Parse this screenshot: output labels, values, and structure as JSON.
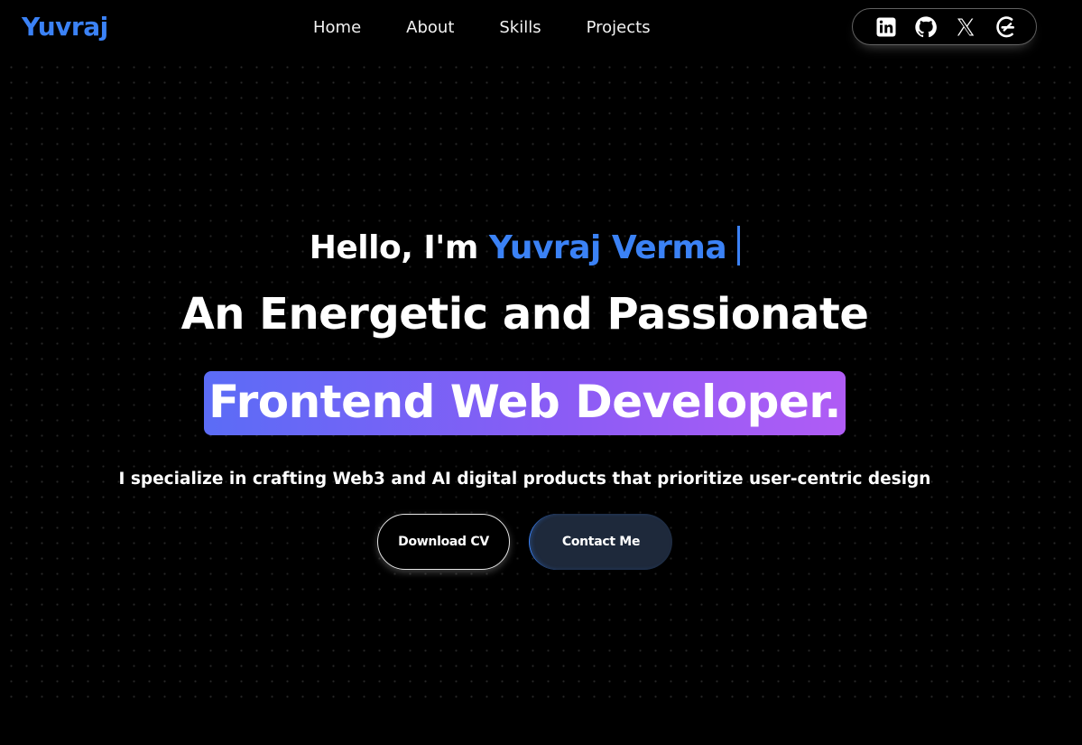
{
  "navbar": {
    "logo": "Yuvraj",
    "links": [
      {
        "label": "Home"
      },
      {
        "label": "About"
      },
      {
        "label": "Skills"
      },
      {
        "label": "Projects"
      }
    ],
    "socials": [
      {
        "icon": "linkedin-icon"
      },
      {
        "icon": "github-icon"
      },
      {
        "icon": "x-twitter-icon"
      },
      {
        "icon": "hashnode-icon"
      }
    ]
  },
  "hero": {
    "greeting_prefix": "Hello, I'm",
    "name": "Yuvraj Verma",
    "headline": "An Energetic and Passionate",
    "role": "Frontend Web Developer.",
    "tagline": "I specialize in crafting Web3 and AI digital products that prioritize user-centric design",
    "buttons": {
      "download": "Download CV",
      "contact": "Contact Me"
    }
  },
  "colors": {
    "background": "#000000",
    "accent_blue": "#3b82f6",
    "gradient_start": "#5b6cf6",
    "gradient_end": "#b05cf5",
    "contact_button": "#1e293b"
  }
}
